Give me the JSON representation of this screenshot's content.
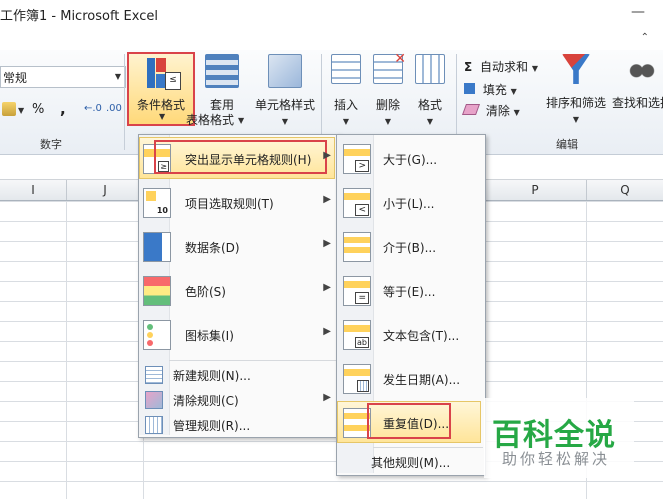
{
  "window": {
    "title": "工作簿1 - Microsoft Excel",
    "min_icon": "minimize-icon",
    "caret": "ribbon-collapse-icon"
  },
  "ribbon": {
    "number_format": "常规",
    "number_group_label": "数字",
    "percent": "%",
    "comma": ",",
    "conditional_format": "条件格式",
    "format_table_line1": "套用",
    "format_table_line2": "表格格式",
    "cell_styles": "单元格样式",
    "insert": "插入",
    "delete": "删除",
    "format": "格式",
    "autosum": "自动求和",
    "fill": "填充",
    "clear": "清除",
    "sort_filter": "排序和筛选",
    "find_select": "查找和选择",
    "edit_group_label": "编辑",
    "sigma": "Σ"
  },
  "columns": [
    "I",
    "J",
    "P",
    "Q"
  ],
  "cf_menu": {
    "items": [
      {
        "label": "突出显示单元格规则(H)",
        "has_sub": true,
        "icon": "highlight-rules-icon"
      },
      {
        "label": "项目选取规则(T)",
        "has_sub": true,
        "icon": "top-bottom-rules-icon"
      },
      {
        "label": "数据条(D)",
        "has_sub": true,
        "icon": "data-bars-icon"
      },
      {
        "label": "色阶(S)",
        "has_sub": true,
        "icon": "color-scales-icon"
      },
      {
        "label": "图标集(I)",
        "has_sub": true,
        "icon": "icon-sets-icon"
      }
    ],
    "small_items": [
      {
        "label": "新建规则(N)...",
        "has_sub": false
      },
      {
        "label": "清除规则(C)",
        "has_sub": true
      },
      {
        "label": "管理规则(R)...",
        "has_sub": false
      }
    ]
  },
  "sub_menu": {
    "items": [
      {
        "label": "大于(G)..."
      },
      {
        "label": "小于(L)..."
      },
      {
        "label": "介于(B)..."
      },
      {
        "label": "等于(E)..."
      },
      {
        "label": "文本包含(T)..."
      },
      {
        "label": "发生日期(A)..."
      },
      {
        "label": "重复值(D)..."
      }
    ],
    "more": "其他规则(M)..."
  },
  "watermark": {
    "title": "百科全说",
    "subtitle": "助你轻松解决"
  },
  "colors": {
    "highlight_box": "#d9434a",
    "menu_hover": "#ffe59a",
    "watermark_green": "#26a845"
  }
}
